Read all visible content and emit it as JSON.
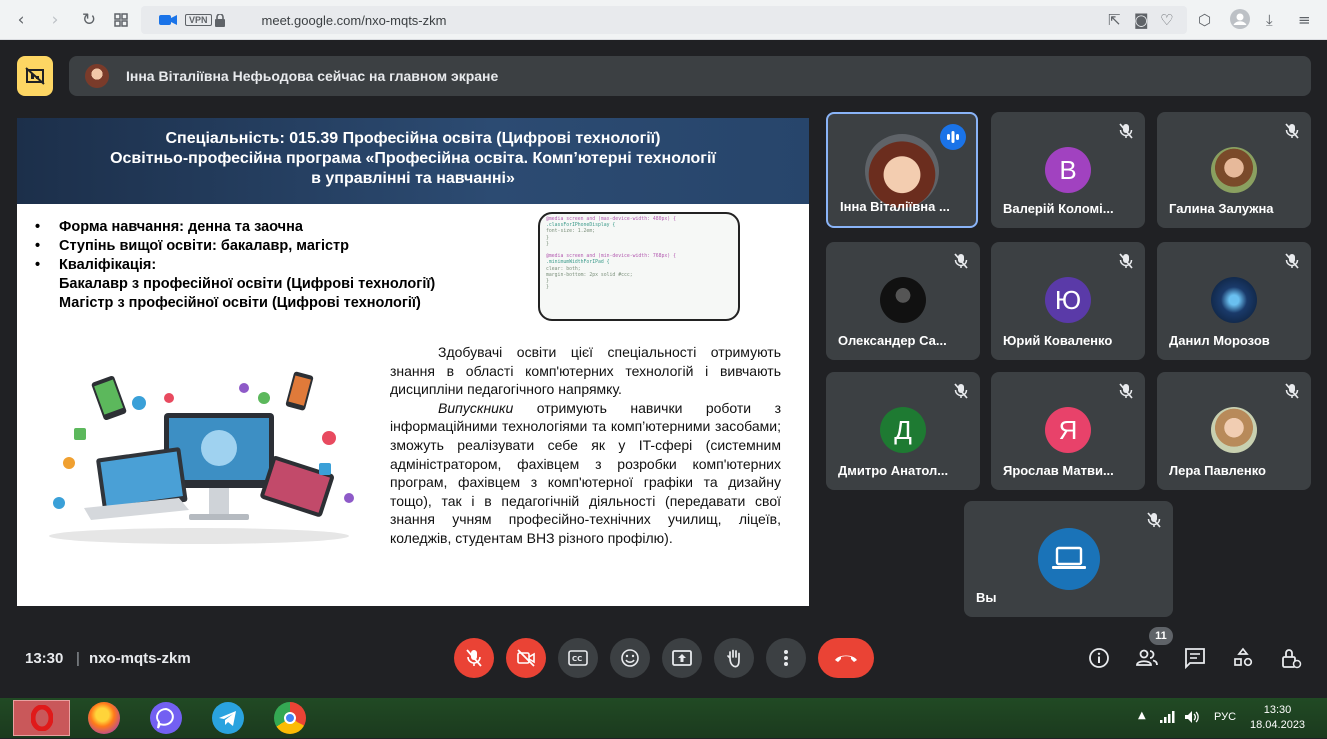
{
  "browser": {
    "vpn": "VPN",
    "url": "meet.google.com/nxo-mqts-zkm"
  },
  "presenting": {
    "text": "Інна Віталіївна Нефьодова сейчас на главном экране"
  },
  "slide": {
    "title_lines": [
      "Спеціальність: 015.39 Професійна освіта (Цифрові технології)",
      "Освітньо-професійна програма «Професійна освіта. Комп’ютерні технології",
      "в управлінні та навчанні»"
    ],
    "bullets": [
      "Форма навчання: денна та заочна",
      "Ступінь вищої освіти: бакалавр, магістр",
      "Кваліфікація:"
    ],
    "qualifications": [
      "Бакалавр з професійної освіти (Цифрові технології)",
      "Магістр з професійної освіти (Цифрові технології)"
    ],
    "paragraph1": "Здобувачі освіти цієї спеціальності отримують знання в області комп'ютерних технологій і вивчають дисципліни педагогічного напрямку.",
    "paragraph2_em": "Випускники",
    "paragraph2": " отримують навички роботи з інформаційними технологіями та комп’ютерними засобами; зможуть реалізувати себе як у IT-сфері (системним адміністратором, фахівцем з розробки комп'ютерних програм, фахівцем з комп'ютерної графіки та дизайну тощо), так і в педагогічній діяльності (передавати свої знання учням професійно-технічних училищ, ліцеїв, коледжів, студентам ВНЗ різного профілю).",
    "code_lines": [
      "@media screen and (max-device-width: 480px) {",
      "  .classForIPhoneDisplay {",
      "    font-size: 1.2em;",
      "  }",
      "}",
      "",
      "@media screen and (min-device-width: 768px) {",
      "  .minimumWidthForIPad {",
      "    clear: both;",
      "    margin-bottom: 2px solid #ccc;",
      "  }",
      "}"
    ]
  },
  "participants": [
    {
      "name": "Інна Віталіївна ...",
      "initial": "",
      "color": "#5f6368",
      "speaking": true
    },
    {
      "name": "Валерій Коломі...",
      "initial": "В",
      "color": "#a142c0",
      "speaking": false
    },
    {
      "name": "Галина Залужна",
      "initial": "",
      "color": "#5f6368",
      "speaking": false
    },
    {
      "name": "Олександер Са...",
      "initial": "",
      "color": "#111111",
      "speaking": false
    },
    {
      "name": "Юрий Коваленко",
      "initial": "Ю",
      "color": "#5a3aa8",
      "speaking": false
    },
    {
      "name": "Данил Морозов",
      "initial": "",
      "color": "#1a3a6a",
      "speaking": false
    },
    {
      "name": "Дмитро Анатол...",
      "initial": "Д",
      "color": "#1e7a32",
      "speaking": false
    },
    {
      "name": "Ярослав Матви...",
      "initial": "Я",
      "color": "#e8426a",
      "speaking": false
    },
    {
      "name": "Лера Павленко",
      "initial": "",
      "color": "#8a9a6a",
      "speaking": false
    },
    {
      "name": "Вы",
      "initial": "",
      "color": "#1a73b8",
      "speaking": false
    }
  ],
  "footer": {
    "time": "13:30",
    "separator": "|",
    "meeting_code": "nxo-mqts-zkm",
    "participant_count": "11"
  },
  "taskbar": {
    "lang": "РУС",
    "clock_time": "13:30",
    "clock_date": "18.04.2023"
  }
}
